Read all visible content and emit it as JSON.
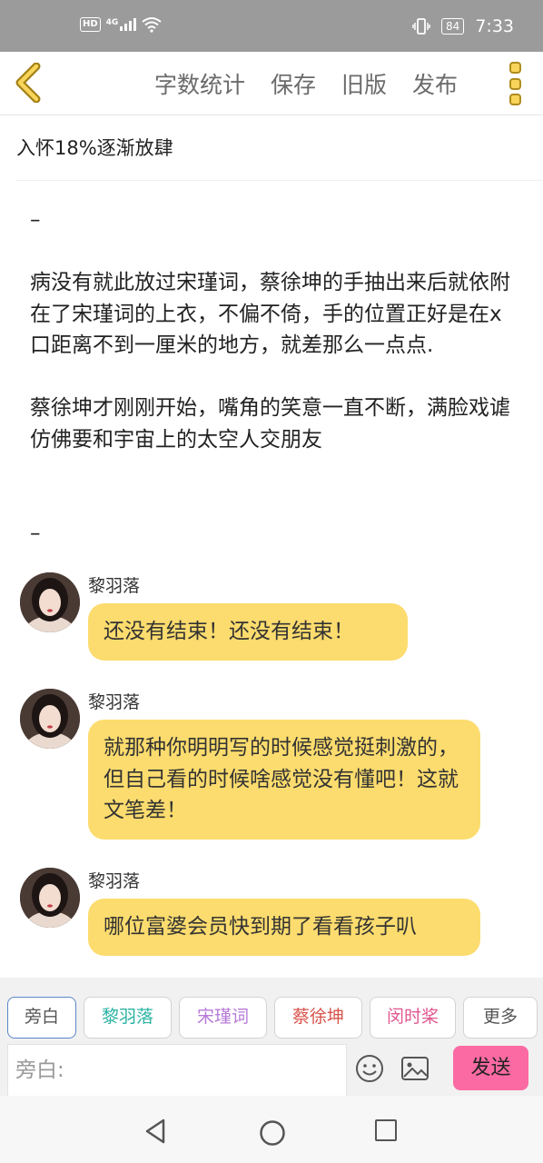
{
  "status_bar": {
    "network_label": "HD",
    "signal_label": "4G",
    "battery": "84",
    "time": "7:33"
  },
  "toolbar": {
    "word_count": "字数统计",
    "save": "保存",
    "old_version": "旧版",
    "publish": "发布"
  },
  "chapter_title": "入怀18%逐渐放肆",
  "body": {
    "separator_top": "–",
    "paragraph_1": "病没有就此放过宋瑾词，蔡徐坤的手抽出来后就依附在了宋瑾词的上衣，不偏不倚，手的位置正好是在x口距离不到一厘米的地方，就差那么一点点.",
    "paragraph_2": "蔡徐坤才刚刚开始，嘴角的笑意一直不断，满脸戏谑仿佛要和宇宙上的太空人交朋友",
    "separator_bottom": "–"
  },
  "messages": [
    {
      "name": "黎羽落",
      "text": "还没有结束！还没有结束！"
    },
    {
      "name": "黎羽落",
      "text": "就那种你明明写的时候感觉挺刺激的，但自己看的时候啥感觉没有懂吧！这就文笔差！"
    },
    {
      "name": "黎羽落",
      "text": "哪位富婆会员快到期了看看孩子叭"
    }
  ],
  "roles": [
    {
      "label": "旁白",
      "color": "#555555"
    },
    {
      "label": "黎羽落",
      "color": "#2bb3a3"
    },
    {
      "label": "宋瑾词",
      "color": "#b77ad8"
    },
    {
      "label": "蔡徐坤",
      "color": "#d9534a"
    },
    {
      "label": "闵时桨",
      "color": "#e0578f"
    },
    {
      "label": "更多",
      "color": "#555555"
    }
  ],
  "input": {
    "placeholder": "旁白:"
  },
  "send_label": "发送",
  "colors": {
    "bubble": "#fcdc6e",
    "send_button": "#fb6aa3",
    "accent_back": "#f8d55a"
  }
}
